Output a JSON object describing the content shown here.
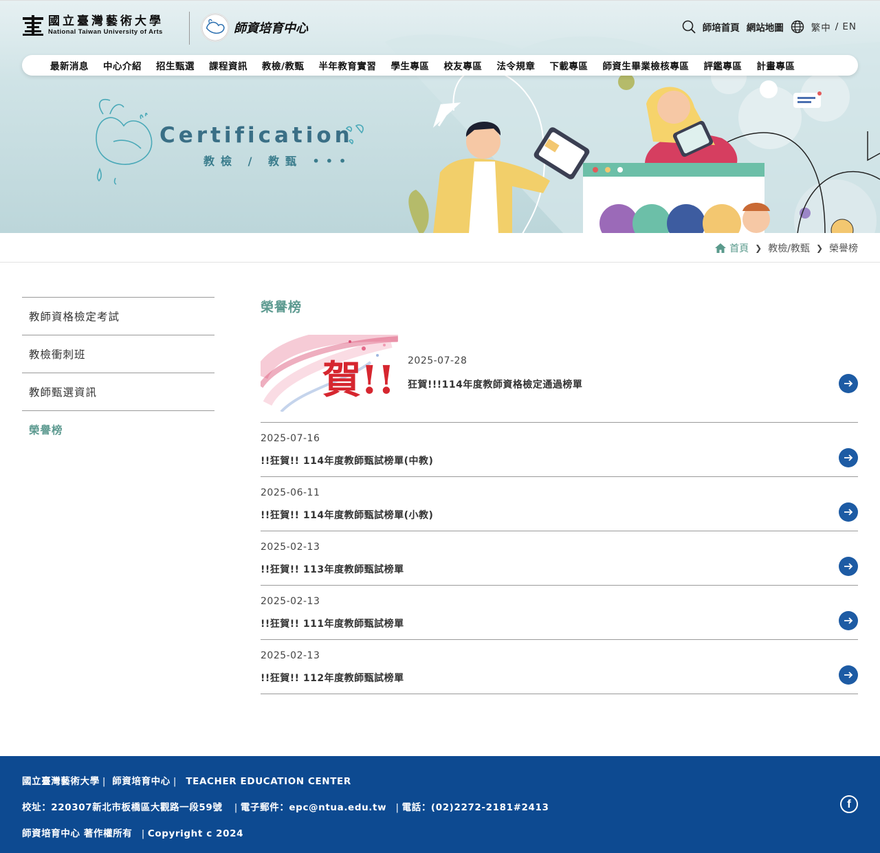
{
  "header": {
    "logo_zh": "國立臺灣藝術大學",
    "logo_en": "National Taiwan University of Arts",
    "center_logo_text": "師資培育中心",
    "top_links": {
      "home": "師培首頁",
      "sitemap": "網站地圖",
      "lang_zh": "繁中",
      "lang_sep": "/",
      "lang_en": "EN"
    }
  },
  "nav": {
    "items": [
      "最新消息",
      "中心介紹",
      "招生甄選",
      "課程資訊",
      "教檢/教甄",
      "半年教育實習",
      "學生專區",
      "校友專區",
      "法令規章",
      "下載專區",
      "師資生畢業檢核專區",
      "評鑑專區",
      "計畫專區"
    ]
  },
  "banner": {
    "title": "Certification",
    "subtitle": "教檢 / 教甄 •••"
  },
  "breadcrumb": {
    "home": "首頁",
    "level1": "教檢/教甄",
    "current": "榮譽榜"
  },
  "sidebar": {
    "items": [
      {
        "label": "教師資格檢定考試"
      },
      {
        "label": "教檢衝刺班"
      },
      {
        "label": "教師甄選資訊"
      },
      {
        "label": "榮譽榜"
      }
    ]
  },
  "main": {
    "title": "榮譽榜",
    "feature": {
      "image_text": "賀!!",
      "date": "2025-07-28",
      "title": "狂賀!!!114年度教師資格檢定通過榜單"
    },
    "news": [
      {
        "date": "2025-07-16",
        "title": "!!狂賀!! 114年度教師甄試榜單(中教)"
      },
      {
        "date": "2025-06-11",
        "title": "!!狂賀!! 114年度教師甄試榜單(小教)"
      },
      {
        "date": "2025-02-13",
        "title": "!!狂賀!! 113年度教師甄試榜單"
      },
      {
        "date": "2025-02-13",
        "title": "!!狂賀!! 111年度教師甄試榜單"
      },
      {
        "date": "2025-02-13",
        "title": "!!狂賀!! 112年度教師甄試榜單"
      }
    ]
  },
  "footer": {
    "org": "國立臺灣藝術大學",
    "dept": "師資培育中心",
    "dept_en": "TEACHER EDUCATION CENTER",
    "address": "校址：220307新北市板橋區大觀路一段59號",
    "email": "電子郵件：epc@ntua.edu.tw",
    "phone": "電話：(02)2272-2181#2413",
    "copyright_owner": "師資培育中心 著作權所有",
    "copyright": "Copyright c 2024",
    "facebook_icon": "facebook-icon"
  },
  "colors": {
    "accent_green": "#5e9b91",
    "arrow_blue": "#1d5ba4",
    "footer_blue": "#0d4a91"
  }
}
